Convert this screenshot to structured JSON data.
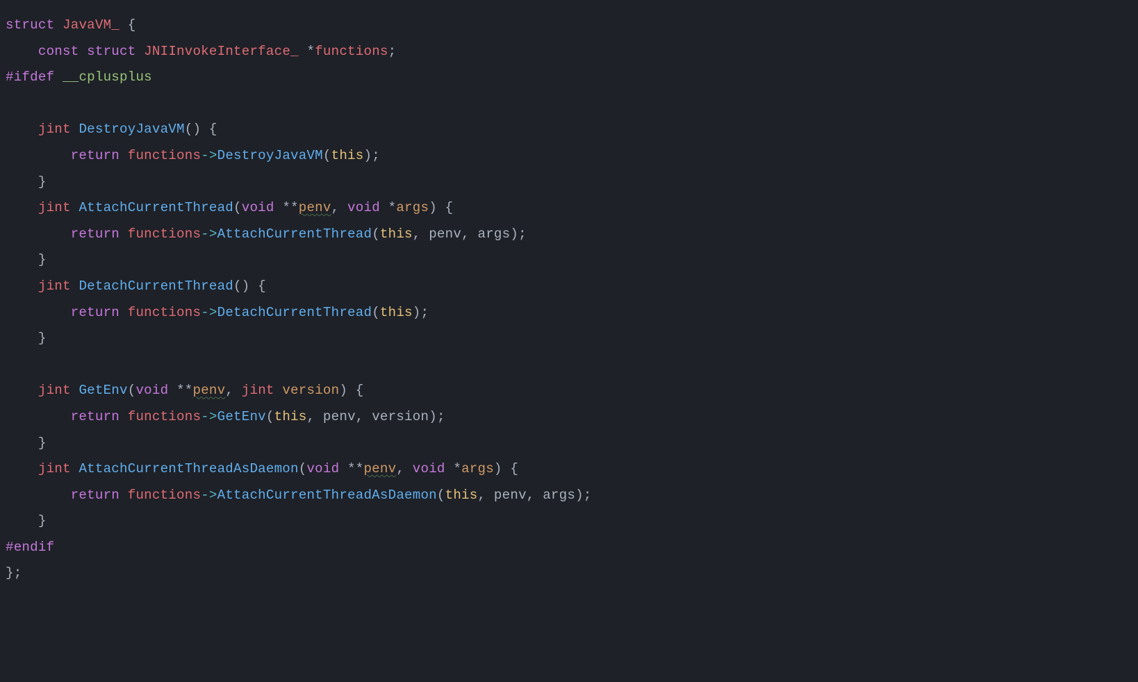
{
  "code": {
    "indent2": "    ",
    "indent4": "        ",
    "kw_struct": "struct",
    "kw_const": "const",
    "kw_return": "return",
    "kw_void": "void",
    "ty_JavaVM_": "JavaVM_",
    "ty_JNIInvokeInterface_": "JNIInvokeInterface_",
    "id_functions": "functions",
    "ty_jint": "jint",
    "pp_ifdef": "#ifdef",
    "pp_endif": "#endif",
    "pp_cplusplus": "__cplusplus",
    "fn_DestroyJavaVM": "DestroyJavaVM",
    "fn_AttachCurrentThread": "AttachCurrentThread",
    "fn_DetachCurrentThread": "DetachCurrentThread",
    "fn_GetEnv": "GetEnv",
    "fn_AttachCurrentThreadAsDaemon": "AttachCurrentThreadAsDaemon",
    "kw_this": "this",
    "id_penv": "penv",
    "id_args": "args",
    "id_version": "version",
    "sym_arrow": "->",
    "sym_star": "*",
    "sym_dstar": "**",
    "sym_obrace": "{",
    "sym_cbrace": "}",
    "sym_oparen": "(",
    "sym_cparen": ")",
    "sym_semi": ";",
    "sym_comma": ",",
    "sym_cbrace_semi": "};"
  }
}
